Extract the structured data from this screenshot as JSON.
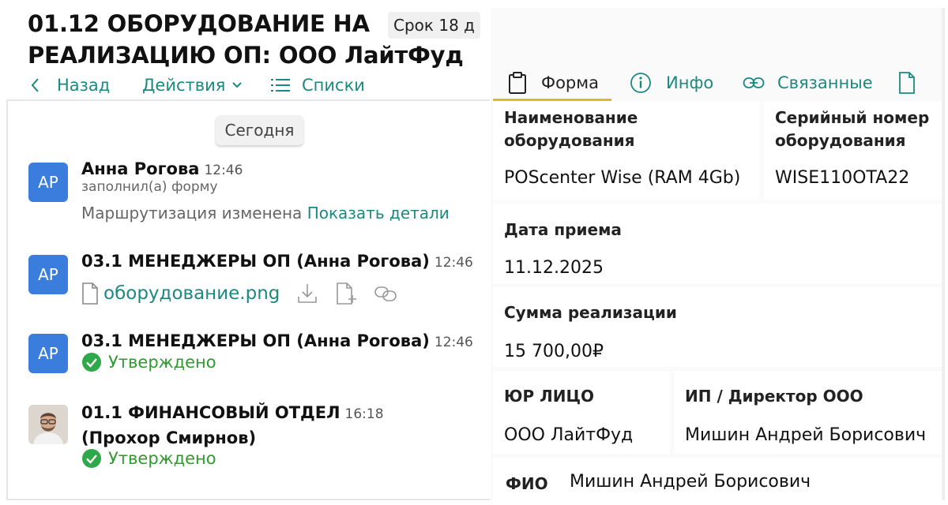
{
  "header": {
    "title": "01.12 ОБОРУДОВАНИЕ НА РЕАЛИЗАЦИЮ ОП: ООО ЛайтФуд",
    "deadline": "Срок 18 д"
  },
  "nav": {
    "back": "Назад",
    "actions": "Действия",
    "lists": "Списки"
  },
  "feed": {
    "date_separator": "Сегодня",
    "events": [
      {
        "avatar": "АР",
        "name": "Анна Рогова",
        "time": "12:46",
        "subtitle": "заполнил(а) форму",
        "detail": "Маршрутизация изменена",
        "detail_link": "Показать детали"
      },
      {
        "avatar": "АР",
        "name": "03.1 МЕНЕДЖЕРЫ ОП (Анна Рогова)",
        "time": "12:46",
        "file": "оборудование.png",
        "file_icons": [
          "download-icon",
          "add-file-icon",
          "link-icon"
        ]
      },
      {
        "avatar": "АР",
        "name": "03.1 МЕНЕДЖЕРЫ ОП (Анна Рогова)",
        "time": "12:46",
        "status": "Утверждено"
      },
      {
        "avatar": "photo",
        "name": "01.1 ФИНАНСОВЫЙ ОТДЕЛ",
        "time": "16:18",
        "name_line2": "(Прохор Смирнов)",
        "status": "Утверждено"
      }
    ]
  },
  "tabs": [
    {
      "label": "Форма",
      "icon": "clipboard-icon",
      "active": true
    },
    {
      "label": "Инфо",
      "icon": "info-icon",
      "active": false
    },
    {
      "label": "Связанные",
      "icon": "link-icon",
      "active": false
    },
    {
      "label": "",
      "icon": "document-icon",
      "active": false
    }
  ],
  "form": {
    "equipment_name": {
      "label": "Наименование оборудования",
      "value": "POScenter Wise (RAM 4Gb)"
    },
    "serial_number": {
      "label": "Серийный номер оборудования",
      "value": "WISE110OTA22"
    },
    "receipt_date": {
      "label": "Дата приема",
      "value": "11.12.2025"
    },
    "sale_amount": {
      "label": "Сумма реализации",
      "value": "15 700,00₽"
    },
    "legal_entity": {
      "label": "ЮР ЛИЦО",
      "value": "ООО ЛайтФуд"
    },
    "director": {
      "label": "ИП / Директор ООО",
      "value": "Мишин Андрей Борисович"
    },
    "full_name": {
      "label": "ФИО",
      "value": "Мишин Андрей Борисович"
    }
  },
  "colors": {
    "accent": "#1a8a80",
    "avatar": "#3a7ddd",
    "approved": "#2f9a2f",
    "tab_underline": "#e9b32a"
  }
}
